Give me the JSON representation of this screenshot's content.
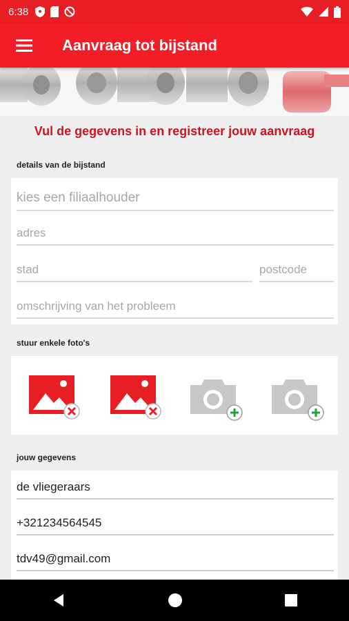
{
  "status_bar": {
    "time": "6:38",
    "icons": [
      "shield-icon",
      "sim-icon",
      "blocked-icon"
    ],
    "right_icons": [
      "wifi-icon",
      "signal-icon",
      "battery-icon"
    ]
  },
  "app_bar": {
    "title": "Aanvraag tot bijstand",
    "menu_icon": "hamburger-menu-icon"
  },
  "heading": "Vul de gegevens in en registreer jouw aanvraag",
  "details_section": {
    "label": "details van de bijstand",
    "fields": {
      "filiaalhouder_placeholder": "kies een filiaalhouder",
      "adres_placeholder": "adres",
      "stad_placeholder": "stad",
      "postcode_placeholder": "postcode",
      "omschrijving_placeholder": "omschrijving van het probleem"
    }
  },
  "photos_section": {
    "label": "stuur enkele foto's",
    "slots": [
      {
        "state": "image",
        "icon": "image-remove-icon"
      },
      {
        "state": "image",
        "icon": "image-remove-icon"
      },
      {
        "state": "empty",
        "icon": "camera-add-icon"
      },
      {
        "state": "empty",
        "icon": "camera-add-icon"
      }
    ]
  },
  "user_section": {
    "label": "jouw gegevens",
    "name": "de vliegeraars",
    "phone": "+321234564545",
    "email": "tdv49@gmail.com"
  },
  "colors": {
    "primary": "#f21d26",
    "heading": "#c9161f",
    "add": "#1fa537",
    "remove": "#e81e25"
  }
}
